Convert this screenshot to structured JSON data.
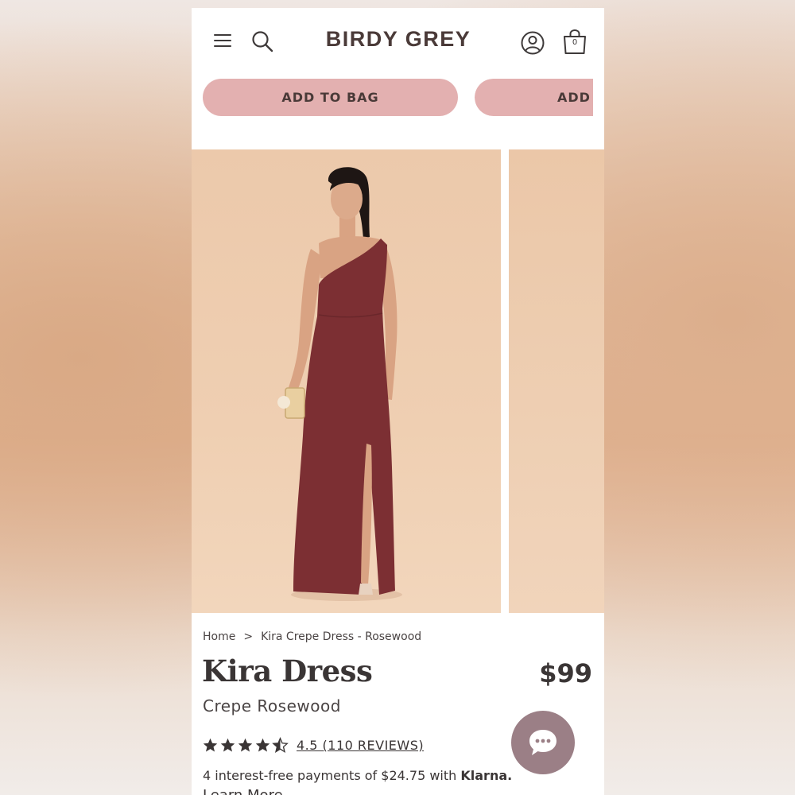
{
  "header": {
    "brand": "BIRDY GREY",
    "bag_count": "0",
    "icons": [
      "menu-icon",
      "search-icon",
      "account-icon",
      "shopping-bag-icon"
    ]
  },
  "actions": {
    "add_to_bag_label": "ADD TO BAG",
    "add_to_bag_partial_label": "ADD T"
  },
  "gallery": {
    "images": [
      "kira-dress-rosewood-front",
      "kira-dress-rosewood-alt"
    ]
  },
  "breadcrumb": {
    "home": "Home",
    "separator": ">",
    "current": "Kira Crepe Dress - Rosewood"
  },
  "product": {
    "title": "Kira Dress",
    "price": "$99",
    "subtitle": "Crepe Rosewood",
    "rating_value": 4.5,
    "rating_max": 5,
    "reviews_link": "4.5 (110 REVIEWS)"
  },
  "payment": {
    "text": "4 interest-free payments of $24.75 with",
    "provider": "Klarna.",
    "learn_more": "Learn More"
  },
  "colors": {
    "button_pink": "#e3b0b0",
    "brand_text": "#4a3a38",
    "chat_bubble": "#9b7f86",
    "dress": "#7c2f33",
    "photo_background": "#eecdb0"
  }
}
